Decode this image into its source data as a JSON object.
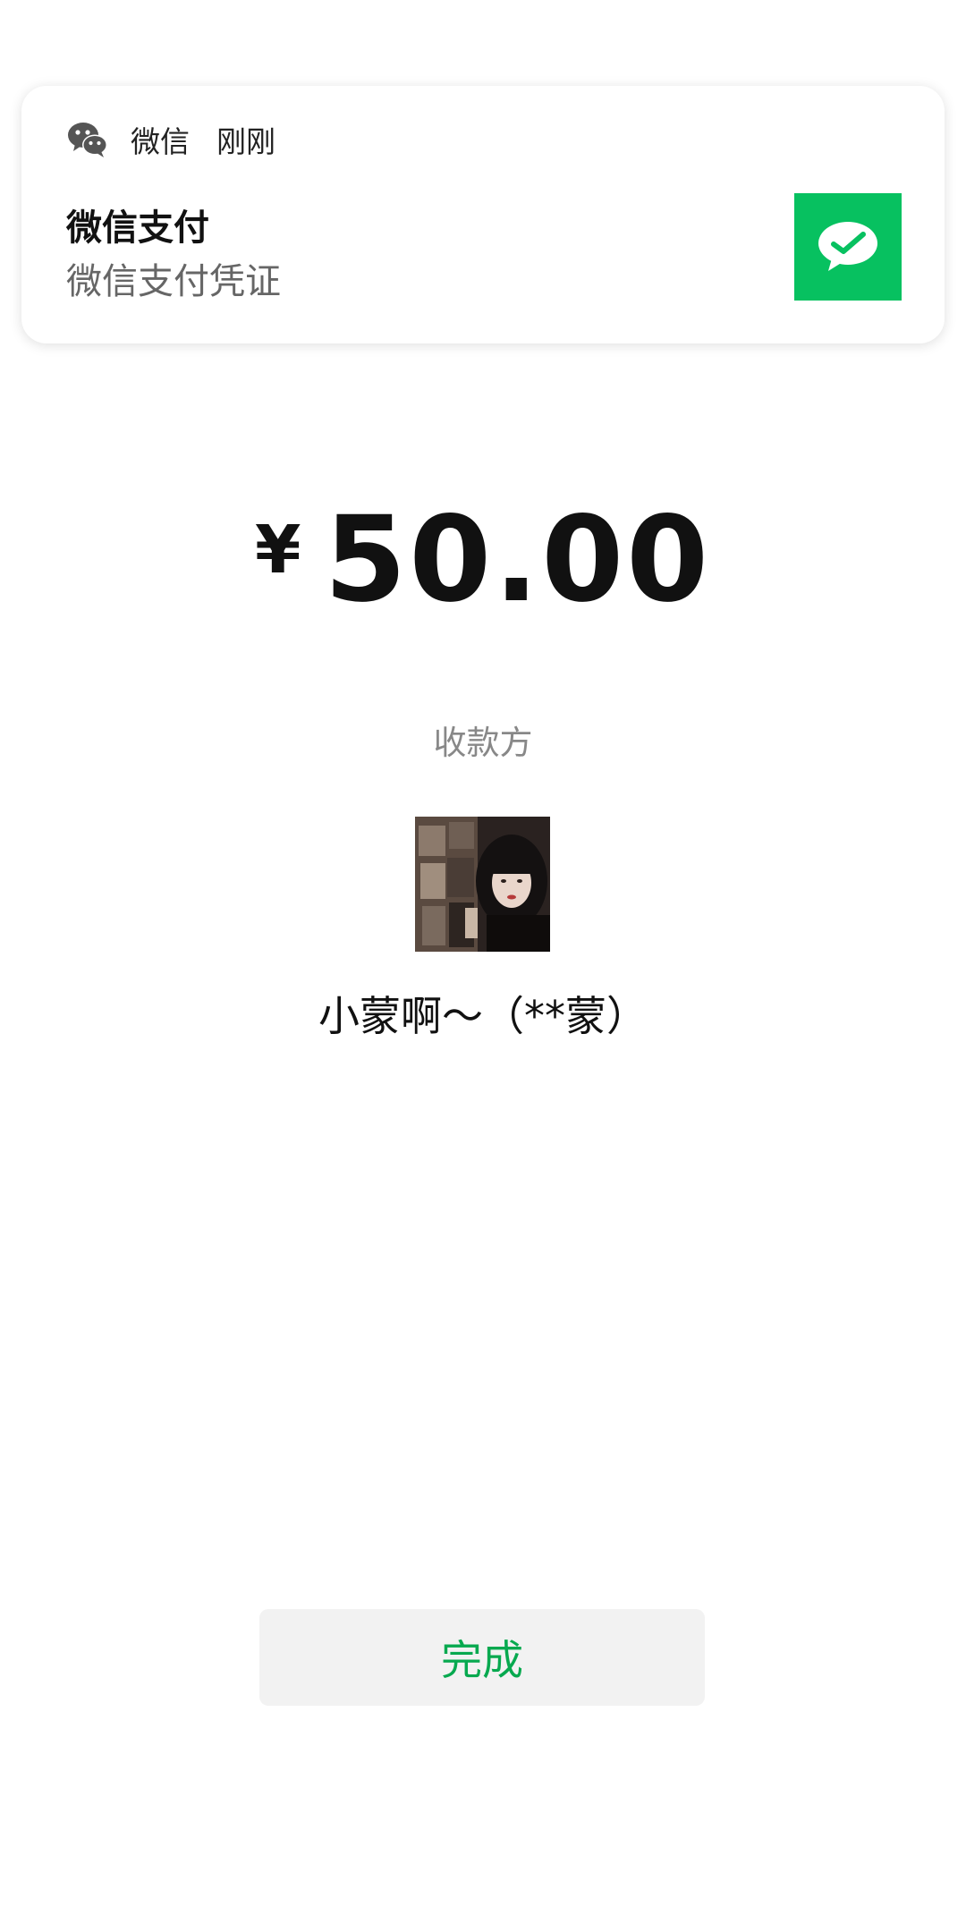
{
  "notification": {
    "app_name": "微信",
    "time": "刚刚",
    "title": "微信支付",
    "body": "微信支付凭证",
    "app_icon": "wechat-icon",
    "thumbnail_icon": "wechat-pay-icon",
    "thumbnail_color": "#07c160"
  },
  "payment": {
    "currency_symbol": "¥",
    "amount": "50.00",
    "payee_label": "收款方",
    "payee_name": "小蒙啊～（**蒙）",
    "avatar": "payee-avatar-photo"
  },
  "actions": {
    "done_label": "完成",
    "done_color": "#07a94f"
  }
}
